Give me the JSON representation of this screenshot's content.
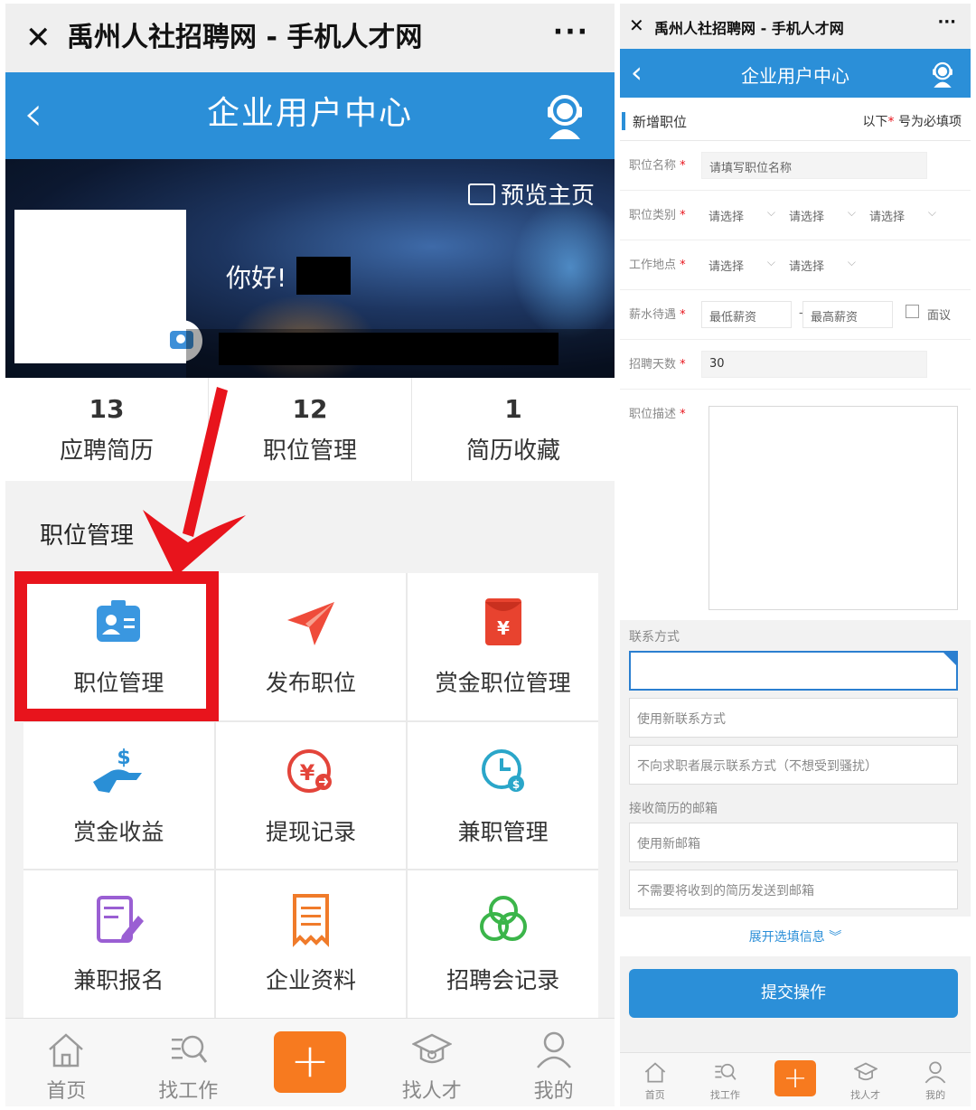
{
  "left": {
    "wechat_bar": {
      "close_glyph": "✕",
      "title": "禹州人社招聘网 - 手机人才网",
      "more_glyph": "···"
    },
    "header": {
      "back_glyph": "‹",
      "title": "企业用户中心",
      "service_icon": "customer-service-icon"
    },
    "banner": {
      "preview_label": "预览主页",
      "greeting": "你好!"
    },
    "stats": [
      {
        "count": "13",
        "label": "应聘简历"
      },
      {
        "count": "12",
        "label": "职位管理"
      },
      {
        "count": "1",
        "label": "简历收藏"
      }
    ],
    "section_title": "职位管理",
    "grid": [
      {
        "label": "职位管理",
        "icon": "id-card-icon",
        "color": "#3a97e0"
      },
      {
        "label": "发布职位",
        "icon": "paper-plane-icon",
        "color": "#ef4b3a"
      },
      {
        "label": "赏金职位管理",
        "icon": "red-envelope-icon",
        "color": "#e8432f"
      },
      {
        "label": "赏金收益",
        "icon": "hand-money-icon",
        "color": "#2a8fd6"
      },
      {
        "label": "提现记录",
        "icon": "yuan-withdraw-icon",
        "color": "#e3443a"
      },
      {
        "label": "兼职管理",
        "icon": "clock-money-icon",
        "color": "#2aa6c9"
      },
      {
        "label": "兼职报名",
        "icon": "edit-document-icon",
        "color": "#9a5fd3"
      },
      {
        "label": "企业资料",
        "icon": "receipt-icon",
        "color": "#f07b2a"
      },
      {
        "label": "招聘会记录",
        "icon": "three-circles-icon",
        "color": "#3bb54a"
      }
    ],
    "tabbar": [
      {
        "label": "首页",
        "icon": "home-icon"
      },
      {
        "label": "找工作",
        "icon": "search-job-icon"
      },
      {
        "label": "",
        "icon": "plus-icon"
      },
      {
        "label": "找人才",
        "icon": "graduation-cap-icon"
      },
      {
        "label": "我的",
        "icon": "user-icon"
      }
    ]
  },
  "right": {
    "wechat_bar": {
      "close_glyph": "✕",
      "title": "禹州人社招聘网 - 手机人才网",
      "more_glyph": "···"
    },
    "header": {
      "back_glyph": "‹",
      "title": "企业用户中心"
    },
    "form_title": "新增职位",
    "required_note_pre": "以下",
    "required_star": "*",
    "required_note_post": " 号为必填项",
    "fields": {
      "job_name": {
        "label": "职位名称",
        "placeholder": "请填写职位名称"
      },
      "job_category": {
        "label": "职位类别",
        "options": [
          "请选择",
          "请选择",
          "请选择"
        ]
      },
      "work_location": {
        "label": "工作地点",
        "options": [
          "请选择",
          "请选择"
        ]
      },
      "salary": {
        "label": "薪水待遇",
        "min_placeholder": "最低薪资",
        "separator": "-",
        "max_placeholder": "最高薪资",
        "negotiable_label": "面议"
      },
      "recruit_days": {
        "label": "招聘天数",
        "value": "30"
      },
      "description": {
        "label": "职位描述"
      }
    },
    "contact": {
      "label": "联系方式",
      "select_value": "",
      "new_contact_placeholder": "使用新联系方式",
      "hide_contact_label": "不向求职者展示联系方式（不想受到骚扰）"
    },
    "email": {
      "label": "接收简历的邮箱",
      "new_email_placeholder": "使用新邮箱",
      "no_email_label": "不需要将收到的简历发送到邮箱"
    },
    "expand_label": "展开选填信息",
    "submit_label": "提交操作",
    "tabbar": [
      {
        "label": "首页",
        "icon": "home-icon"
      },
      {
        "label": "找工作",
        "icon": "search-job-icon"
      },
      {
        "label": "",
        "icon": "plus-icon"
      },
      {
        "label": "找人才",
        "icon": "graduation-cap-icon"
      },
      {
        "label": "我的",
        "icon": "user-icon"
      }
    ]
  }
}
